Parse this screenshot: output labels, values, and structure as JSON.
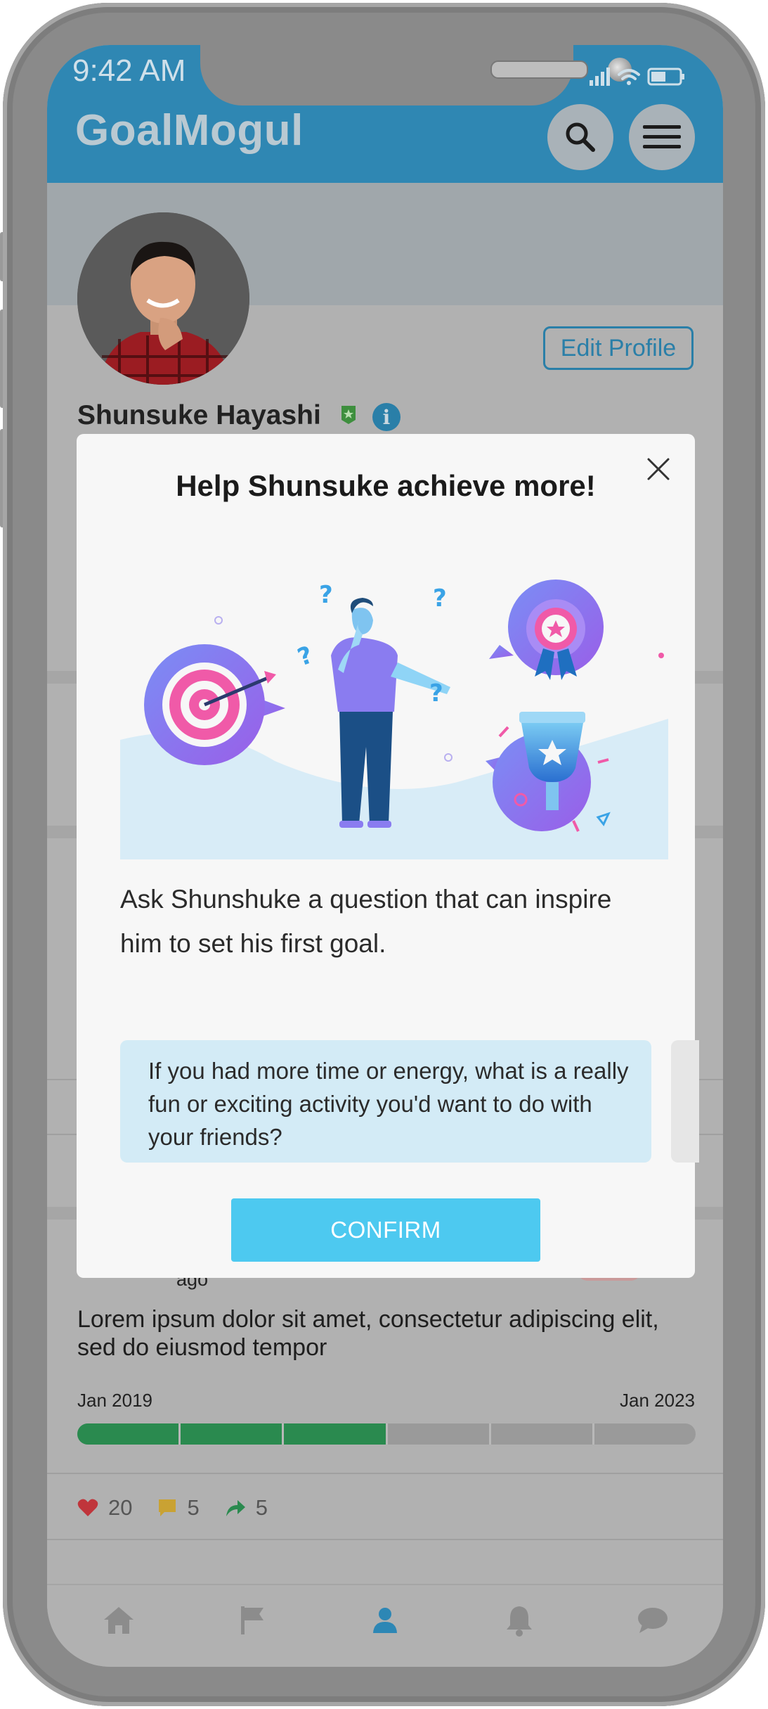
{
  "status_bar": {
    "time": "9:42 AM"
  },
  "header": {
    "app_title": "GoalMogul"
  },
  "profile": {
    "name": "Shunsuke Hayashi",
    "edit_profile_label": "Edit Profile"
  },
  "modal": {
    "title": "Help Shunsuke achieve more!",
    "prompt": "Ask Shunshuke a question that can inspire him to set his first goal.",
    "question": "If you had more time or energy, what is a really fun or exciting activity you'd want to do with your friends?",
    "confirm_label": "CONFIRM"
  },
  "post": {
    "ago": "ago",
    "text": "Lorem ipsum dolor sit amet, consectetur adipiscing elit, sed do eiusmod tempor",
    "date_start": "Jan 2019",
    "date_end": "Jan 2023",
    "progress_segments_total": 6,
    "progress_segments_done": 3,
    "likes": "20",
    "comments": "5",
    "shares": "5"
  },
  "tabbar": {
    "tabs": [
      {
        "icon": "home-icon",
        "active": false
      },
      {
        "icon": "flag-icon",
        "active": false
      },
      {
        "icon": "profile-icon",
        "active": true
      },
      {
        "icon": "bell-icon",
        "active": false
      },
      {
        "icon": "chat-icon",
        "active": false
      }
    ]
  },
  "colors": {
    "header_blue": "#2f87b3",
    "accent_blue": "#4dc9f0",
    "progress_green": "#2a8a4f",
    "question_card_bg": "#d3ebf6"
  }
}
